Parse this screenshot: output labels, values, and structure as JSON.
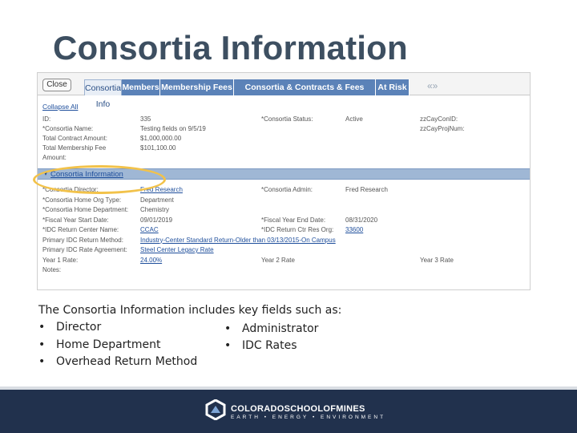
{
  "slide": {
    "title": "Consortia Information"
  },
  "panel": {
    "close_label": "Close",
    "tabs": [
      {
        "label": "Consortia Info"
      },
      {
        "label": "Members"
      },
      {
        "label": "Membership Fees"
      },
      {
        "label": "Consortia & Contracts & Fees Docs"
      },
      {
        "label": "At Risk"
      }
    ],
    "more_icon": "«»",
    "collapse_all": "Collapse All",
    "header_rows": [
      {
        "l1": "ID:",
        "v1": "335",
        "l2": "*Consortia Status:",
        "v2": "Active",
        "l3": "zzCayConID:"
      },
      {
        "l1": "*Consortia Name:",
        "v1": "Testing fields on 9/5/19",
        "l2": "",
        "v2": "",
        "l3": "zzCayProjNum:"
      },
      {
        "l1": "Total Contract Amount:",
        "v1": "$1,000,000.00",
        "l2": "",
        "v2": "",
        "l3": ""
      },
      {
        "l1": "Total Membership Fee",
        "v1": "$101,100.00",
        "l2": "",
        "v2": "",
        "l3": ""
      },
      {
        "l1": "Amount:",
        "v1": "",
        "l2": "",
        "v2": "",
        "l3": ""
      }
    ],
    "section_title": "Consortia Information",
    "section_caret": "▾",
    "info_rows": [
      {
        "l1": "*Consortia Director:",
        "v1": "Fred Research",
        "l2": "*Consortia Admin:",
        "v2": "Fred Research",
        "l3": ""
      },
      {
        "l1": "*Consortia Home Org Type:",
        "v1": "Department",
        "l2": "",
        "v2": "",
        "l3": ""
      },
      {
        "l1": "*Consortia Home Department:",
        "v1": "Chemistry",
        "l2": "",
        "v2": "",
        "l3": ""
      },
      {
        "l1": "*Fiscal Year Start Date:",
        "v1": "09/01/2019",
        "l2": "*Fiscal Year End Date:",
        "v2": "08/31/2020",
        "l3": ""
      },
      {
        "l1": "*IDC Return Center Name:",
        "v1": "CCAC",
        "l2": "*IDC Return Ctr Res Org:",
        "v2": "33600",
        "l3": ""
      },
      {
        "l1": "Primary IDC Return Method:",
        "v1": "Industry-Center Standard Return-Older than 03/13/2015-On Campus",
        "l2": "",
        "v2": "",
        "l3": ""
      },
      {
        "l1": "Primary IDC Rate Agreement:",
        "v1": "Steel Center Legacy Rate",
        "l2": "",
        "v2": "",
        "l3": ""
      },
      {
        "l1": "Year 1 Rate:",
        "v1": "24.00%",
        "l2": "Year 2 Rate",
        "v2": "",
        "l3": "Year 3 Rate"
      },
      {
        "l1": "Notes:",
        "v1": "",
        "l2": "",
        "v2": "",
        "l3": ""
      }
    ]
  },
  "description": {
    "intro": "The Consortia Information includes key fields such as:",
    "bullet_char": "•",
    "left_bullets": [
      "Director",
      "Home Department",
      "Overhead Return Method"
    ],
    "right_bullets": [
      "Administrator",
      "IDC Rates"
    ]
  },
  "footer": {
    "logo_text": "COLORADOSCHOOLOFMINES",
    "logo_sub": "EARTH • ENERGY • ENVIRONMENT",
    "logo_icon": "mines-logo-icon"
  },
  "colors": {
    "title": "#3d4f61",
    "tab": "#5b82b8",
    "section_bar": "#9fb7d5",
    "highlight": "#f2c24a",
    "footer": "#21314d"
  }
}
